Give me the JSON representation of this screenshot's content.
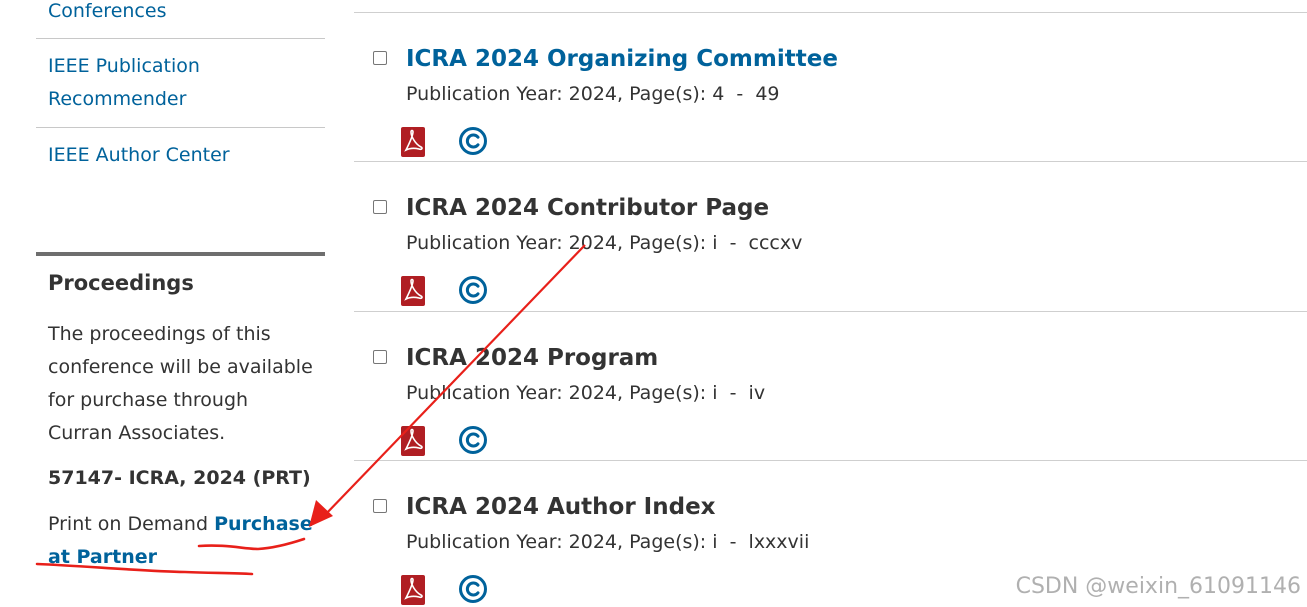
{
  "sidebar": {
    "links": [
      "Conferences",
      "IEEE Publication Recommender",
      "IEEE Author Center"
    ],
    "proceedings": {
      "title": "Proceedings",
      "text": "The proceedings of this conference will be available for purchase through Curran Associates.",
      "code": "57147- ICRA, 2024 (PRT)",
      "pod_prefix": "Print on Demand ",
      "pod_link": "Purchase at Partner"
    }
  },
  "items": [
    {
      "title": "ICRA 2024 Organizing Committee",
      "year_label": "Publication Year: 2024",
      "pages_label": ", Page(s): 4  -  49",
      "linked": true
    },
    {
      "title": "ICRA 2024 Contributor Page",
      "year_label": "Publication Year: 2024",
      "pages_label": ", Page(s): i  -  cccxv",
      "linked": false
    },
    {
      "title": "ICRA 2024 Program",
      "year_label": "Publication Year: 2024",
      "pages_label": ", Page(s): i  -  iv",
      "linked": false
    },
    {
      "title": "ICRA 2024 Author Index",
      "year_label": "Publication Year: 2024",
      "pages_label": ", Page(s): i  -  lxxxvii",
      "linked": false
    }
  ],
  "icons": {
    "pdf": "pdf-icon",
    "copyright": "copyright-icon"
  },
  "colors": {
    "link": "#00629b",
    "text": "#333333",
    "pdf": "#b01e23",
    "annotation": "#e8201a"
  },
  "watermark": "CSDN @weixin_61091146"
}
